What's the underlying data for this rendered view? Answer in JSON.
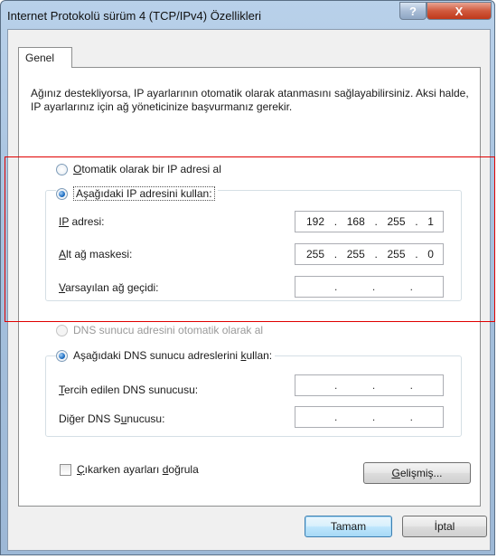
{
  "window": {
    "title": "Internet Protokolü sürüm 4 (TCP/IPv4) Özellikleri",
    "help_label": "?",
    "close_label": "X"
  },
  "tab": {
    "label": "Genel"
  },
  "description": "Ağınız destekliyorsa, IP ayarlarının otomatik olarak atanmasını sağlayabilirsiniz. Aksi halde, IP ayarlarınız için ağ yöneticinize başvurmanız gerekir.",
  "ip_section": {
    "auto_radio": {
      "underlined": "O",
      "rest": "tomatik olarak bir IP adresi al",
      "checked": false
    },
    "manual_radio": {
      "label": "Aşağıdaki IP adresini kullan:",
      "checked": true
    },
    "fields": [
      {
        "u": "IP",
        "rest": " adresi:",
        "octets": [
          "192",
          "168",
          "255",
          "1"
        ]
      },
      {
        "u": "A",
        "rest": "lt ağ maskesi:",
        "octets": [
          "255",
          "255",
          "255",
          "0"
        ]
      },
      {
        "u": "V",
        "rest": "arsayılan ağ geçidi:",
        "octets": [
          "",
          "",
          "",
          ""
        ]
      }
    ]
  },
  "dns_section": {
    "auto_radio": {
      "label": "DNS sunucu adresini otomatik olarak al",
      "checked": false,
      "disabled": true
    },
    "manual_radio": {
      "pre": "Aşağıdaki DNS sunucu adreslerini ",
      "u": "k",
      "post": "ullan:",
      "checked": true
    },
    "fields": [
      {
        "u": "T",
        "rest": "ercih edilen DNS sunucusu:",
        "octets": [
          "",
          "",
          "",
          ""
        ]
      },
      {
        "pre": "Diğer DNS S",
        "u": "u",
        "post": "nucusu:",
        "octets": [
          "",
          "",
          "",
          ""
        ]
      }
    ]
  },
  "validate_checkbox": {
    "u": "Ç",
    "rest": "ıkarken ayarları ",
    "u2": "d",
    "rest2": "oğrula",
    "checked": false
  },
  "buttons": {
    "advanced": {
      "u": "G",
      "rest": "elişmiş..."
    },
    "ok": "Tamam",
    "cancel": "İptal"
  },
  "colors": {
    "highlight_border": "#e00000",
    "radio_selected": "#1f6fc4",
    "close_button": "#c0391b"
  }
}
